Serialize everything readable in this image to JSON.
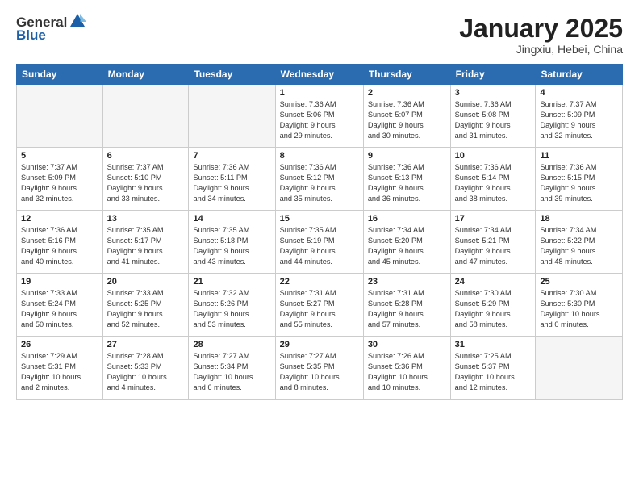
{
  "header": {
    "logo_general": "General",
    "logo_blue": "Blue",
    "month": "January 2025",
    "location": "Jingxiu, Hebei, China"
  },
  "days_of_week": [
    "Sunday",
    "Monday",
    "Tuesday",
    "Wednesday",
    "Thursday",
    "Friday",
    "Saturday"
  ],
  "weeks": [
    [
      {
        "day": "",
        "content": ""
      },
      {
        "day": "",
        "content": ""
      },
      {
        "day": "",
        "content": ""
      },
      {
        "day": "1",
        "content": "Sunrise: 7:36 AM\nSunset: 5:06 PM\nDaylight: 9 hours\nand 29 minutes."
      },
      {
        "day": "2",
        "content": "Sunrise: 7:36 AM\nSunset: 5:07 PM\nDaylight: 9 hours\nand 30 minutes."
      },
      {
        "day": "3",
        "content": "Sunrise: 7:36 AM\nSunset: 5:08 PM\nDaylight: 9 hours\nand 31 minutes."
      },
      {
        "day": "4",
        "content": "Sunrise: 7:37 AM\nSunset: 5:09 PM\nDaylight: 9 hours\nand 32 minutes."
      }
    ],
    [
      {
        "day": "5",
        "content": "Sunrise: 7:37 AM\nSunset: 5:09 PM\nDaylight: 9 hours\nand 32 minutes."
      },
      {
        "day": "6",
        "content": "Sunrise: 7:37 AM\nSunset: 5:10 PM\nDaylight: 9 hours\nand 33 minutes."
      },
      {
        "day": "7",
        "content": "Sunrise: 7:36 AM\nSunset: 5:11 PM\nDaylight: 9 hours\nand 34 minutes."
      },
      {
        "day": "8",
        "content": "Sunrise: 7:36 AM\nSunset: 5:12 PM\nDaylight: 9 hours\nand 35 minutes."
      },
      {
        "day": "9",
        "content": "Sunrise: 7:36 AM\nSunset: 5:13 PM\nDaylight: 9 hours\nand 36 minutes."
      },
      {
        "day": "10",
        "content": "Sunrise: 7:36 AM\nSunset: 5:14 PM\nDaylight: 9 hours\nand 38 minutes."
      },
      {
        "day": "11",
        "content": "Sunrise: 7:36 AM\nSunset: 5:15 PM\nDaylight: 9 hours\nand 39 minutes."
      }
    ],
    [
      {
        "day": "12",
        "content": "Sunrise: 7:36 AM\nSunset: 5:16 PM\nDaylight: 9 hours\nand 40 minutes."
      },
      {
        "day": "13",
        "content": "Sunrise: 7:35 AM\nSunset: 5:17 PM\nDaylight: 9 hours\nand 41 minutes."
      },
      {
        "day": "14",
        "content": "Sunrise: 7:35 AM\nSunset: 5:18 PM\nDaylight: 9 hours\nand 43 minutes."
      },
      {
        "day": "15",
        "content": "Sunrise: 7:35 AM\nSunset: 5:19 PM\nDaylight: 9 hours\nand 44 minutes."
      },
      {
        "day": "16",
        "content": "Sunrise: 7:34 AM\nSunset: 5:20 PM\nDaylight: 9 hours\nand 45 minutes."
      },
      {
        "day": "17",
        "content": "Sunrise: 7:34 AM\nSunset: 5:21 PM\nDaylight: 9 hours\nand 47 minutes."
      },
      {
        "day": "18",
        "content": "Sunrise: 7:34 AM\nSunset: 5:22 PM\nDaylight: 9 hours\nand 48 minutes."
      }
    ],
    [
      {
        "day": "19",
        "content": "Sunrise: 7:33 AM\nSunset: 5:24 PM\nDaylight: 9 hours\nand 50 minutes."
      },
      {
        "day": "20",
        "content": "Sunrise: 7:33 AM\nSunset: 5:25 PM\nDaylight: 9 hours\nand 52 minutes."
      },
      {
        "day": "21",
        "content": "Sunrise: 7:32 AM\nSunset: 5:26 PM\nDaylight: 9 hours\nand 53 minutes."
      },
      {
        "day": "22",
        "content": "Sunrise: 7:31 AM\nSunset: 5:27 PM\nDaylight: 9 hours\nand 55 minutes."
      },
      {
        "day": "23",
        "content": "Sunrise: 7:31 AM\nSunset: 5:28 PM\nDaylight: 9 hours\nand 57 minutes."
      },
      {
        "day": "24",
        "content": "Sunrise: 7:30 AM\nSunset: 5:29 PM\nDaylight: 9 hours\nand 58 minutes."
      },
      {
        "day": "25",
        "content": "Sunrise: 7:30 AM\nSunset: 5:30 PM\nDaylight: 10 hours\nand 0 minutes."
      }
    ],
    [
      {
        "day": "26",
        "content": "Sunrise: 7:29 AM\nSunset: 5:31 PM\nDaylight: 10 hours\nand 2 minutes."
      },
      {
        "day": "27",
        "content": "Sunrise: 7:28 AM\nSunset: 5:33 PM\nDaylight: 10 hours\nand 4 minutes."
      },
      {
        "day": "28",
        "content": "Sunrise: 7:27 AM\nSunset: 5:34 PM\nDaylight: 10 hours\nand 6 minutes."
      },
      {
        "day": "29",
        "content": "Sunrise: 7:27 AM\nSunset: 5:35 PM\nDaylight: 10 hours\nand 8 minutes."
      },
      {
        "day": "30",
        "content": "Sunrise: 7:26 AM\nSunset: 5:36 PM\nDaylight: 10 hours\nand 10 minutes."
      },
      {
        "day": "31",
        "content": "Sunrise: 7:25 AM\nSunset: 5:37 PM\nDaylight: 10 hours\nand 12 minutes."
      },
      {
        "day": "",
        "content": ""
      }
    ]
  ]
}
